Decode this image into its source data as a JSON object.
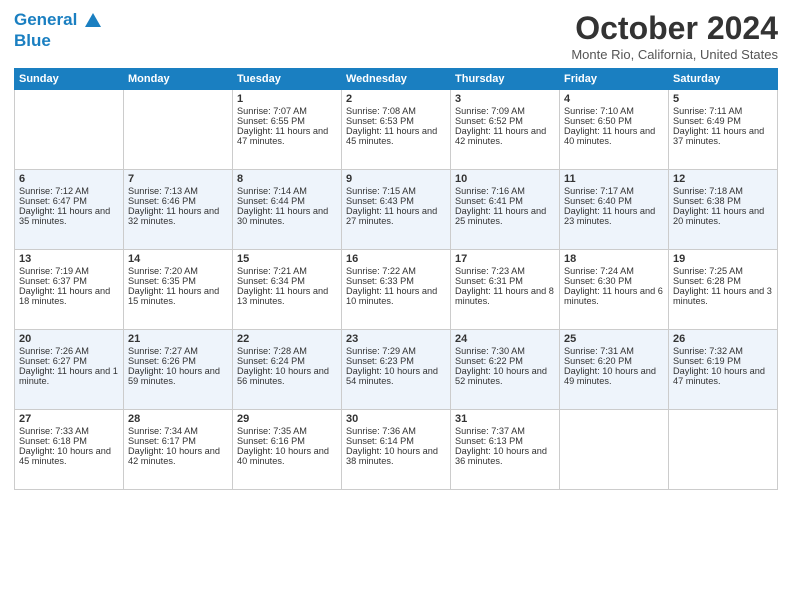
{
  "logo": {
    "line1": "General",
    "line2": "Blue"
  },
  "title": "October 2024",
  "location": "Monte Rio, California, United States",
  "days_header": [
    "Sunday",
    "Monday",
    "Tuesday",
    "Wednesday",
    "Thursday",
    "Friday",
    "Saturday"
  ],
  "weeks": [
    [
      {
        "day": "",
        "info": ""
      },
      {
        "day": "",
        "info": ""
      },
      {
        "day": "1",
        "info": "Sunrise: 7:07 AM\nSunset: 6:55 PM\nDaylight: 11 hours and 47 minutes."
      },
      {
        "day": "2",
        "info": "Sunrise: 7:08 AM\nSunset: 6:53 PM\nDaylight: 11 hours and 45 minutes."
      },
      {
        "day": "3",
        "info": "Sunrise: 7:09 AM\nSunset: 6:52 PM\nDaylight: 11 hours and 42 minutes."
      },
      {
        "day": "4",
        "info": "Sunrise: 7:10 AM\nSunset: 6:50 PM\nDaylight: 11 hours and 40 minutes."
      },
      {
        "day": "5",
        "info": "Sunrise: 7:11 AM\nSunset: 6:49 PM\nDaylight: 11 hours and 37 minutes."
      }
    ],
    [
      {
        "day": "6",
        "info": "Sunrise: 7:12 AM\nSunset: 6:47 PM\nDaylight: 11 hours and 35 minutes."
      },
      {
        "day": "7",
        "info": "Sunrise: 7:13 AM\nSunset: 6:46 PM\nDaylight: 11 hours and 32 minutes."
      },
      {
        "day": "8",
        "info": "Sunrise: 7:14 AM\nSunset: 6:44 PM\nDaylight: 11 hours and 30 minutes."
      },
      {
        "day": "9",
        "info": "Sunrise: 7:15 AM\nSunset: 6:43 PM\nDaylight: 11 hours and 27 minutes."
      },
      {
        "day": "10",
        "info": "Sunrise: 7:16 AM\nSunset: 6:41 PM\nDaylight: 11 hours and 25 minutes."
      },
      {
        "day": "11",
        "info": "Sunrise: 7:17 AM\nSunset: 6:40 PM\nDaylight: 11 hours and 23 minutes."
      },
      {
        "day": "12",
        "info": "Sunrise: 7:18 AM\nSunset: 6:38 PM\nDaylight: 11 hours and 20 minutes."
      }
    ],
    [
      {
        "day": "13",
        "info": "Sunrise: 7:19 AM\nSunset: 6:37 PM\nDaylight: 11 hours and 18 minutes."
      },
      {
        "day": "14",
        "info": "Sunrise: 7:20 AM\nSunset: 6:35 PM\nDaylight: 11 hours and 15 minutes."
      },
      {
        "day": "15",
        "info": "Sunrise: 7:21 AM\nSunset: 6:34 PM\nDaylight: 11 hours and 13 minutes."
      },
      {
        "day": "16",
        "info": "Sunrise: 7:22 AM\nSunset: 6:33 PM\nDaylight: 11 hours and 10 minutes."
      },
      {
        "day": "17",
        "info": "Sunrise: 7:23 AM\nSunset: 6:31 PM\nDaylight: 11 hours and 8 minutes."
      },
      {
        "day": "18",
        "info": "Sunrise: 7:24 AM\nSunset: 6:30 PM\nDaylight: 11 hours and 6 minutes."
      },
      {
        "day": "19",
        "info": "Sunrise: 7:25 AM\nSunset: 6:28 PM\nDaylight: 11 hours and 3 minutes."
      }
    ],
    [
      {
        "day": "20",
        "info": "Sunrise: 7:26 AM\nSunset: 6:27 PM\nDaylight: 11 hours and 1 minute."
      },
      {
        "day": "21",
        "info": "Sunrise: 7:27 AM\nSunset: 6:26 PM\nDaylight: 10 hours and 59 minutes."
      },
      {
        "day": "22",
        "info": "Sunrise: 7:28 AM\nSunset: 6:24 PM\nDaylight: 10 hours and 56 minutes."
      },
      {
        "day": "23",
        "info": "Sunrise: 7:29 AM\nSunset: 6:23 PM\nDaylight: 10 hours and 54 minutes."
      },
      {
        "day": "24",
        "info": "Sunrise: 7:30 AM\nSunset: 6:22 PM\nDaylight: 10 hours and 52 minutes."
      },
      {
        "day": "25",
        "info": "Sunrise: 7:31 AM\nSunset: 6:20 PM\nDaylight: 10 hours and 49 minutes."
      },
      {
        "day": "26",
        "info": "Sunrise: 7:32 AM\nSunset: 6:19 PM\nDaylight: 10 hours and 47 minutes."
      }
    ],
    [
      {
        "day": "27",
        "info": "Sunrise: 7:33 AM\nSunset: 6:18 PM\nDaylight: 10 hours and 45 minutes."
      },
      {
        "day": "28",
        "info": "Sunrise: 7:34 AM\nSunset: 6:17 PM\nDaylight: 10 hours and 42 minutes."
      },
      {
        "day": "29",
        "info": "Sunrise: 7:35 AM\nSunset: 6:16 PM\nDaylight: 10 hours and 40 minutes."
      },
      {
        "day": "30",
        "info": "Sunrise: 7:36 AM\nSunset: 6:14 PM\nDaylight: 10 hours and 38 minutes."
      },
      {
        "day": "31",
        "info": "Sunrise: 7:37 AM\nSunset: 6:13 PM\nDaylight: 10 hours and 36 minutes."
      },
      {
        "day": "",
        "info": ""
      },
      {
        "day": "",
        "info": ""
      }
    ]
  ]
}
